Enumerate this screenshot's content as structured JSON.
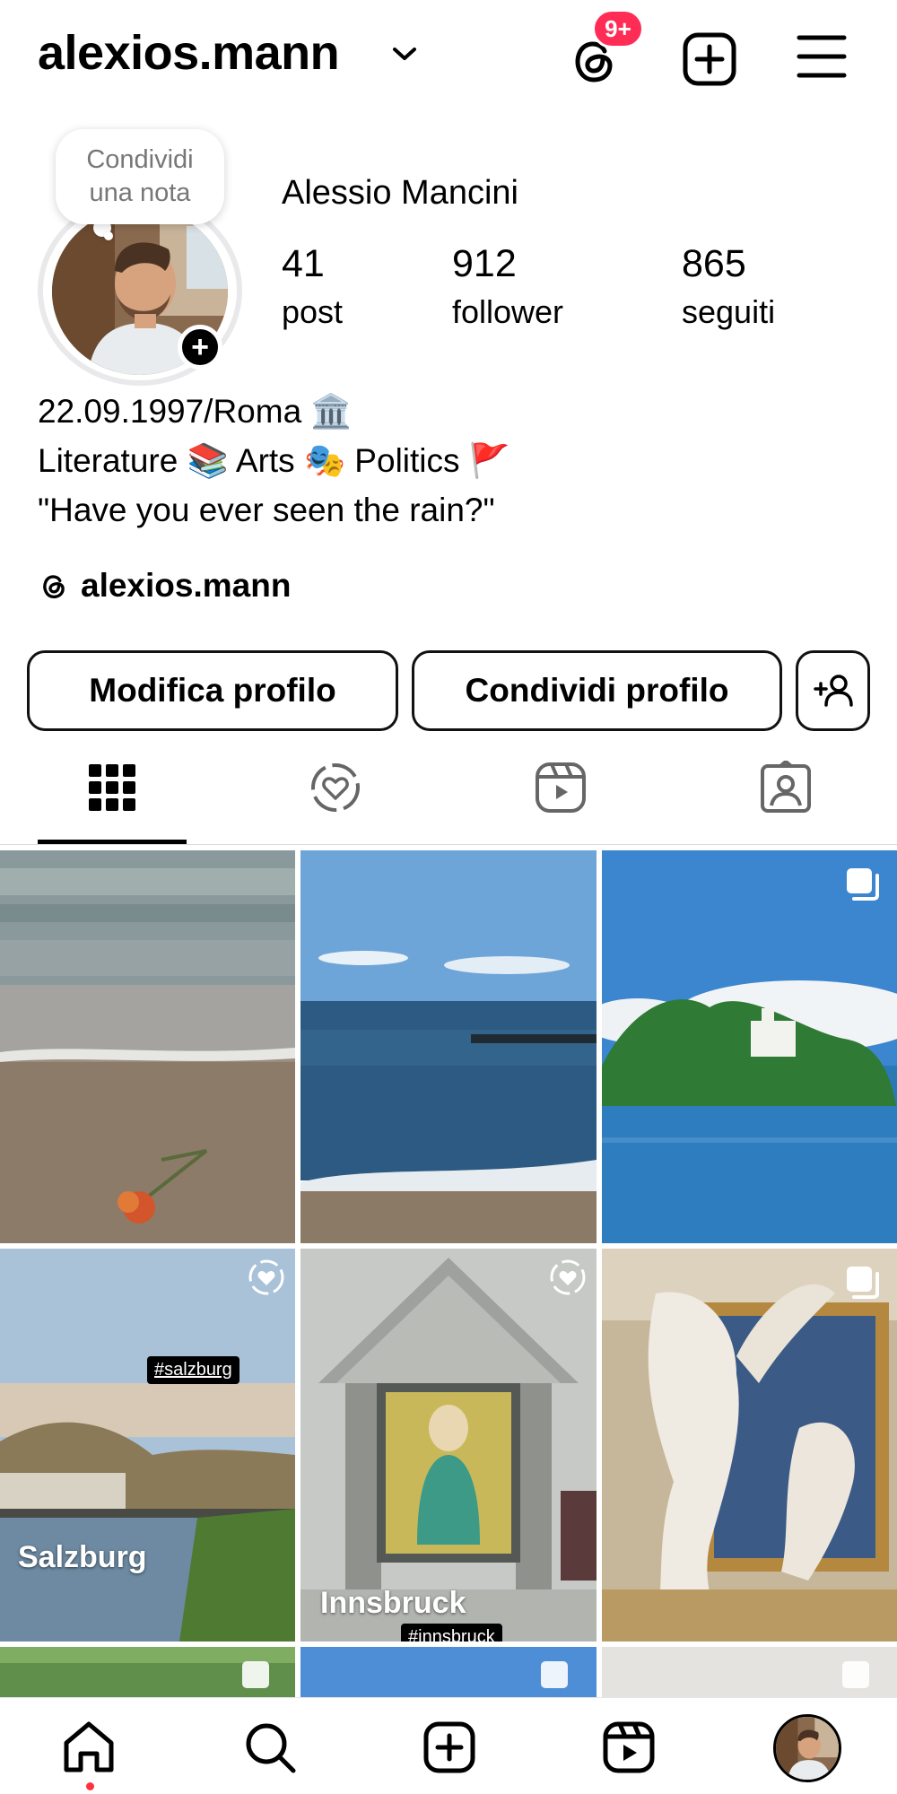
{
  "header": {
    "username": "alexios.mann",
    "threads_badge": "9+"
  },
  "profile": {
    "note_line1": "Condividi",
    "note_line2": "una nota",
    "full_name": "Alessio Mancini",
    "stats": [
      {
        "value": "41",
        "label": "post"
      },
      {
        "value": "912",
        "label": "follower"
      },
      {
        "value": "865",
        "label": "seguiti"
      }
    ],
    "bio_lines": [
      "22.09.1997/Roma 🏛️",
      "Literature 📚 Arts 🎭 Politics 🚩",
      "\"Have you ever seen the rain?\""
    ],
    "threads_handle": "alexios.mann"
  },
  "buttons": {
    "edit_profile": "Modifica profilo",
    "share_profile": "Condividi profilo"
  },
  "tabs": [
    "grid-tab",
    "reposts-tab",
    "reels-tab",
    "tagged-tab"
  ],
  "grid": {
    "posts": [
      {
        "scene": "beach-rose",
        "type": "photo"
      },
      {
        "scene": "sea-waves",
        "type": "photo"
      },
      {
        "scene": "lake-castle",
        "type": "carousel"
      },
      {
        "scene": "salzburg-river",
        "type": "repost",
        "hashtag": "#salzburg",
        "place": "Salzburg"
      },
      {
        "scene": "church-mosaic",
        "type": "repost",
        "hashtag": "#innsbruck",
        "place": "Innsbruck"
      },
      {
        "scene": "marble-statue",
        "type": "carousel"
      }
    ]
  },
  "colors": {
    "badge": "#ff2d55",
    "text": "#000000",
    "muted": "#777777",
    "notification_dot": "#ff3040"
  }
}
